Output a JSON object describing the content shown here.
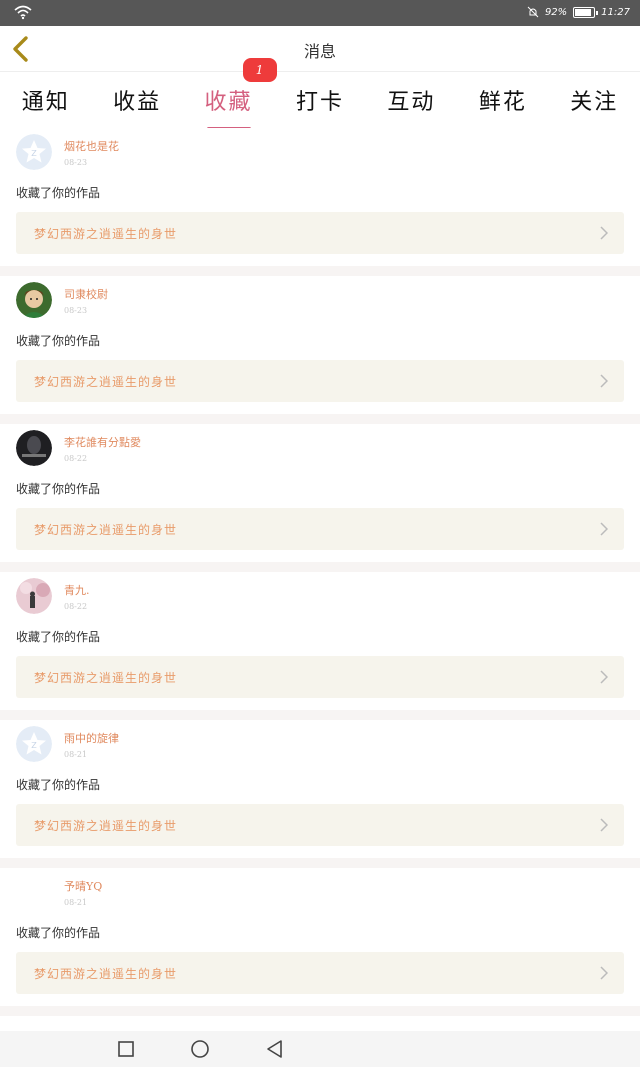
{
  "status_bar": {
    "battery": "92%",
    "time": "11:27"
  },
  "header": {
    "title": "消息"
  },
  "tabs": [
    {
      "label": "通知"
    },
    {
      "label": "收益"
    },
    {
      "label": "收藏",
      "active": true,
      "badge": "1"
    },
    {
      "label": "打卡"
    },
    {
      "label": "互动"
    },
    {
      "label": "鲜花"
    },
    {
      "label": "关注"
    }
  ],
  "notifications": [
    {
      "username": "烟花也是花",
      "date": "08-23",
      "action": "收藏了你的作品",
      "work_title": "梦幻西游之逍遥生的身世",
      "avatar": "default-star-avatar"
    },
    {
      "username": "司隶校尉",
      "date": "08-23",
      "action": "收藏了你的作品",
      "work_title": "梦幻西游之逍遥生的身世",
      "avatar": "cartoon-avatar"
    },
    {
      "username": "李花誰有分點愛",
      "date": "08-22",
      "action": "收藏了你的作品",
      "work_title": "梦幻西游之逍遥生的身世",
      "avatar": "dark-photo-avatar"
    },
    {
      "username": "青九.",
      "date": "08-22",
      "action": "收藏了你的作品",
      "work_title": "梦幻西游之逍遥生的身世",
      "avatar": "pink-photo-avatar"
    },
    {
      "username": "雨中的旋律",
      "date": "08-21",
      "action": "收藏了你的作品",
      "work_title": "梦幻西游之逍遥生的身世",
      "avatar": "default-star-avatar"
    },
    {
      "username": "予晴YQ",
      "date": "08-21",
      "action": "收藏了你的作品",
      "work_title": "梦幻西游之逍遥生的身世",
      "avatar": "blank-avatar"
    }
  ],
  "colors": {
    "accent": "#d4607f",
    "username": "#e08a5f",
    "badge": "#ee3b3b",
    "card_link_bg": "#f6f4ec"
  },
  "icons": {
    "back": "chevron-left-icon",
    "work_link": "chevron-right-icon",
    "nav": [
      "recent-apps-icon",
      "home-icon",
      "back-triangle-icon"
    ]
  }
}
